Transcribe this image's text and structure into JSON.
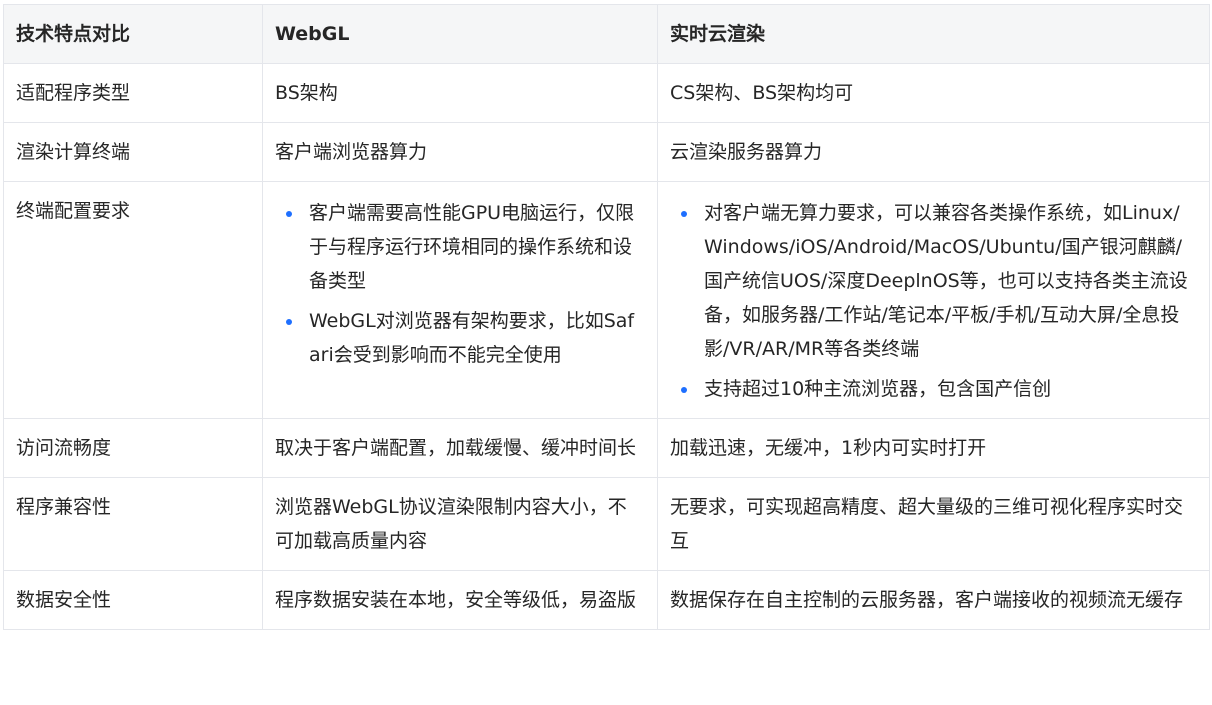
{
  "table": {
    "headers": [
      "技术特点对比",
      "WebGL",
      "实时云渲染"
    ],
    "rows": [
      {
        "label": "适配程序类型",
        "webgl": "BS架构",
        "cloud": "CS架构、BS架构均可"
      },
      {
        "label": "渲染计算终端",
        "webgl": "客户端浏览器算力",
        "cloud": "云渲染服务器算力"
      },
      {
        "label": "终端配置要求",
        "webgl_items": [
          "客户端需要高性能GPU电脑运行，仅限于与程序运行环境相同的操作系统和设备类型",
          "WebGL对浏览器有架构要求，比如Safari会受到影响而不能完全使用"
        ],
        "cloud_items": [
          "对客户端无算力要求，可以兼容各类操作系统，如Linux/Windows/iOS/Android/MacOS/Ubuntu/国产银河麒麟/国产统信UOS/深度DeeplnOS等，也可以支持各类主流设备，如服务器/工作站/笔记本/平板/手机/互动大屏/全息投影/VR/AR/MR等各类终端",
          "支持超过10种主流浏览器，包含国产信创"
        ]
      },
      {
        "label": "访问流畅度",
        "webgl": "取决于客户端配置，加载缓慢、缓冲时间长",
        "cloud": "加载迅速，无缓冲，1秒内可实时打开"
      },
      {
        "label": "程序兼容性",
        "webgl": "浏览器WebGL协议渲染限制内容大小，不可加载高质量内容",
        "cloud": "无要求，可实现超高精度、超大量级的三维可视化程序实时交互"
      },
      {
        "label": "数据安全性",
        "webgl": "程序数据安装在本地，安全等级低，易盗版",
        "cloud": "数据保存在自主控制的云服务器，客户端接收的视频流无缓存"
      }
    ]
  },
  "colors": {
    "bullet": "#1e6fff",
    "border": "#e4e6eb",
    "header_bg": "#f5f6f7"
  }
}
